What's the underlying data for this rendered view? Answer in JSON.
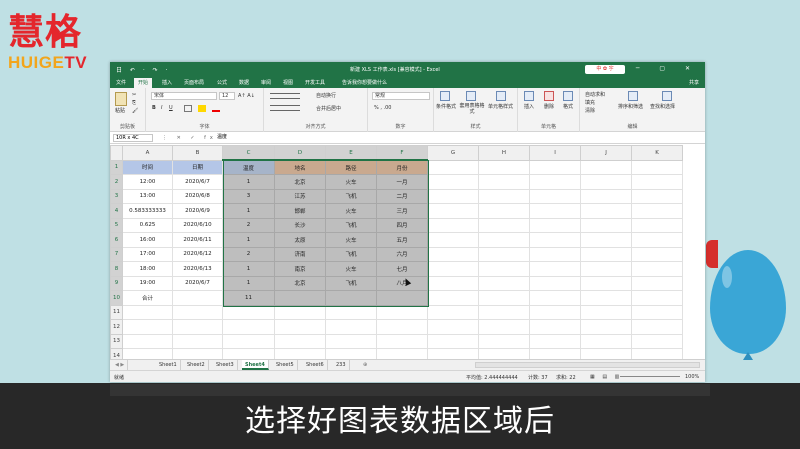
{
  "logo": {
    "cn": "慧格",
    "en_main": "HUIGE",
    "en_tv": "TV"
  },
  "window": {
    "title": "新建 XLS 工作表.xls [兼容模式] - Excel",
    "qat": "日 ↶ · ↷ ·",
    "badge": "中 ✿ 字",
    "controls": "▭ ─ ▢ ✕"
  },
  "tabs": [
    "文件",
    "开始",
    "插入",
    "页面布局",
    "公式",
    "数据",
    "审阅",
    "视图",
    "开发工具",
    "告诉我你想要做什么"
  ],
  "share": "共享",
  "ribbon": {
    "paste": "粘贴",
    "cut": "✂",
    "copy": "⎘",
    "format_painter": "🖌",
    "clipboard_label": "剪贴板",
    "font_name": "宋体",
    "font_size": "12",
    "font_grow": "A↑ A↓",
    "bold": "B",
    "italic": "I",
    "underline": "U",
    "font_label": "字体",
    "wrap": "自动换行",
    "merge": "合并后居中",
    "align_label": "对齐方式",
    "num_format": "常规",
    "num_tools": "% , .00",
    "number_label": "数字",
    "cond_format": "条件格式",
    "table_format": "套用表格格式",
    "cell_style": "单元格样式",
    "style_label": "样式",
    "insert": "插入",
    "delete": "删除",
    "format": "格式",
    "cells_label": "单元格",
    "autosum": "自动求和",
    "fill": "填充",
    "clear": "清除",
    "sort": "排序和筛选",
    "find": "查找和选择",
    "edit_label": "编辑"
  },
  "formula_bar": {
    "name_box": "10R x 4C",
    "fx_icons": "⋮ ✕ ✓ fx",
    "content": "温度"
  },
  "columns": [
    "A",
    "B",
    "C",
    "D",
    "E",
    "F",
    "G",
    "H",
    "I",
    "J",
    "K"
  ],
  "rows": [
    [
      "时间",
      "日期",
      "温度",
      "地名",
      "路径",
      "月份",
      "",
      "",
      "",
      "",
      ""
    ],
    [
      "12:00",
      "2020/6/7",
      "1",
      "北京",
      "火车",
      "一月",
      "",
      "",
      "",
      "",
      ""
    ],
    [
      "13:00",
      "2020/6/8",
      "3",
      "江苏",
      "飞机",
      "二月",
      "",
      "",
      "",
      "",
      ""
    ],
    [
      "0.583333333",
      "2020/6/9",
      "1",
      "邯郸",
      "火车",
      "三月",
      "",
      "",
      "",
      "",
      ""
    ],
    [
      "0.625",
      "2020/6/10",
      "2",
      "长沙",
      "飞机",
      "四月",
      "",
      "",
      "",
      "",
      ""
    ],
    [
      "16:00",
      "2020/6/11",
      "1",
      "太原",
      "火车",
      "五月",
      "",
      "",
      "",
      "",
      ""
    ],
    [
      "17:00",
      "2020/6/12",
      "2",
      "济南",
      "飞机",
      "六月",
      "",
      "",
      "",
      "",
      ""
    ],
    [
      "18:00",
      "2020/6/13",
      "1",
      "南京",
      "火车",
      "七月",
      "",
      "",
      "",
      "",
      ""
    ],
    [
      "19:00",
      "2020/6/7",
      "1",
      "北京",
      "飞机",
      "八月",
      "",
      "",
      "",
      "",
      ""
    ],
    [
      "合计",
      "",
      "11",
      "",
      "",
      "",
      "",
      "",
      "",
      "",
      ""
    ],
    [
      "",
      "",
      "",
      "",
      "",
      "",
      "",
      "",
      "",
      "",
      ""
    ],
    [
      "",
      "",
      "",
      "",
      "",
      "",
      "",
      "",
      "",
      "",
      ""
    ],
    [
      "",
      "",
      "",
      "",
      "",
      "",
      "",
      "",
      "",
      "",
      ""
    ],
    [
      "",
      "",
      "",
      "",
      "",
      "",
      "",
      "",
      "",
      "",
      ""
    ]
  ],
  "sheets": [
    "Sheet1",
    "Sheet2",
    "Sheet3",
    "Sheet4",
    "Sheet5",
    "Sheet6",
    "233"
  ],
  "active_sheet": "Sheet4",
  "status": {
    "mode": "就绪",
    "average": "平均值: 2.444444444",
    "count": "计数: 37",
    "sum": "求和: 22",
    "zoom": "100%"
  },
  "caption": "选择好图表数据区域后",
  "colors": {
    "excel_green": "#217346",
    "header_blue": "#b4c6e7",
    "header_orange": "#f4b183",
    "background": "#bfe0e4",
    "balloon": "#3aa6d6"
  }
}
